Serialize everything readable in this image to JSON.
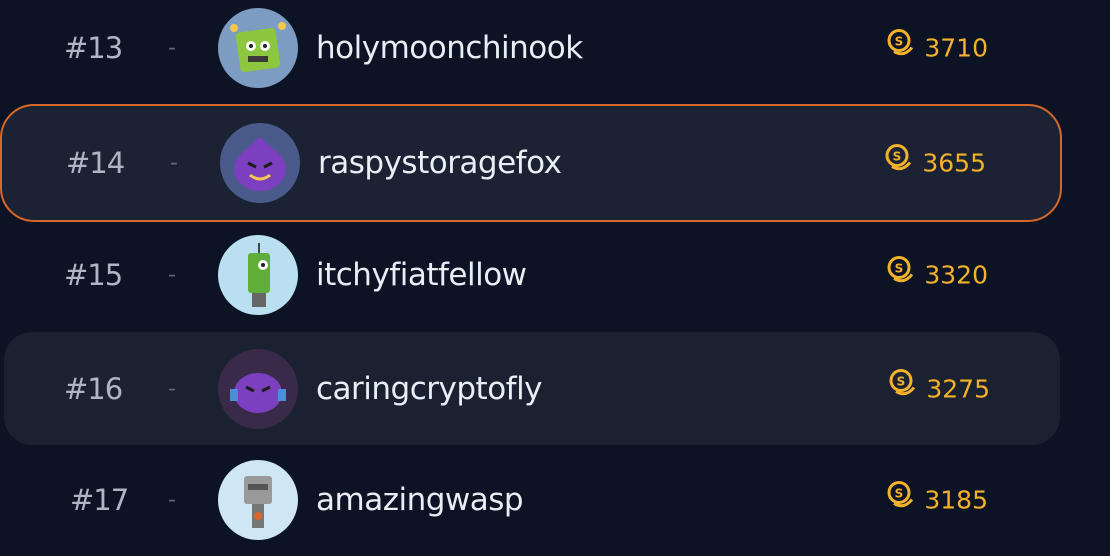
{
  "leaderboard": {
    "entries": [
      {
        "rank": "#13",
        "separator": "-",
        "username": "holymoonchinook",
        "score": "3710",
        "avatar": "green-robot-avatar"
      },
      {
        "rank": "#14",
        "separator": "-",
        "username": "raspystoragefox",
        "score": "3655",
        "avatar": "purple-blob-avatar",
        "highlighted": true
      },
      {
        "rank": "#15",
        "separator": "-",
        "username": "itchyfiatfellow",
        "score": "3320",
        "avatar": "green-robot-tall-avatar"
      },
      {
        "rank": "#16",
        "separator": "-",
        "username": "caringcryptofly",
        "score": "3275",
        "avatar": "purple-blob-avatar"
      },
      {
        "rank": "#17",
        "separator": "-",
        "username": "amazingwasp",
        "score": "3185",
        "avatar": "grey-robot-avatar"
      }
    ]
  },
  "colors": {
    "background": "#0b1324",
    "highlight_border": "#d9662a",
    "score": "#f4b22a"
  }
}
